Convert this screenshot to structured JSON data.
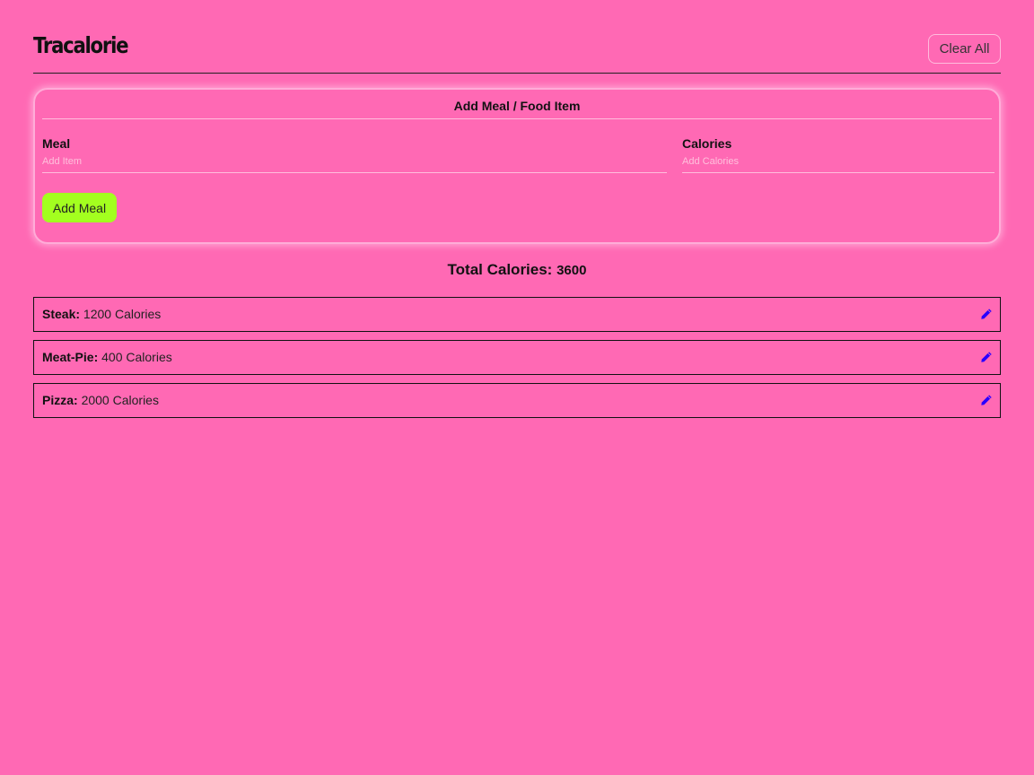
{
  "header": {
    "title": "Tracalorie",
    "clear_label": "Clear All"
  },
  "form": {
    "title": "Add Meal / Food Item",
    "meal_label": "Meal",
    "meal_placeholder": "Add Item",
    "meal_value": "",
    "calories_label": "Calories",
    "calories_placeholder": "Add Calories",
    "calories_value": "",
    "add_label": "Add Meal"
  },
  "total": {
    "label": "Total Calories:",
    "value": "3600"
  },
  "meals": [
    {
      "name": "Steak:",
      "calories": "1200 Calories"
    },
    {
      "name": "Meat-Pie:",
      "calories": "400 Calories"
    },
    {
      "name": "Pizza:",
      "calories": "2000 Calories"
    }
  ],
  "icons": {
    "edit": "pencil-icon"
  },
  "colors": {
    "background": "#ff69b4",
    "add_button": "#a3ff1f",
    "edit_icon": "#2a00ff"
  }
}
